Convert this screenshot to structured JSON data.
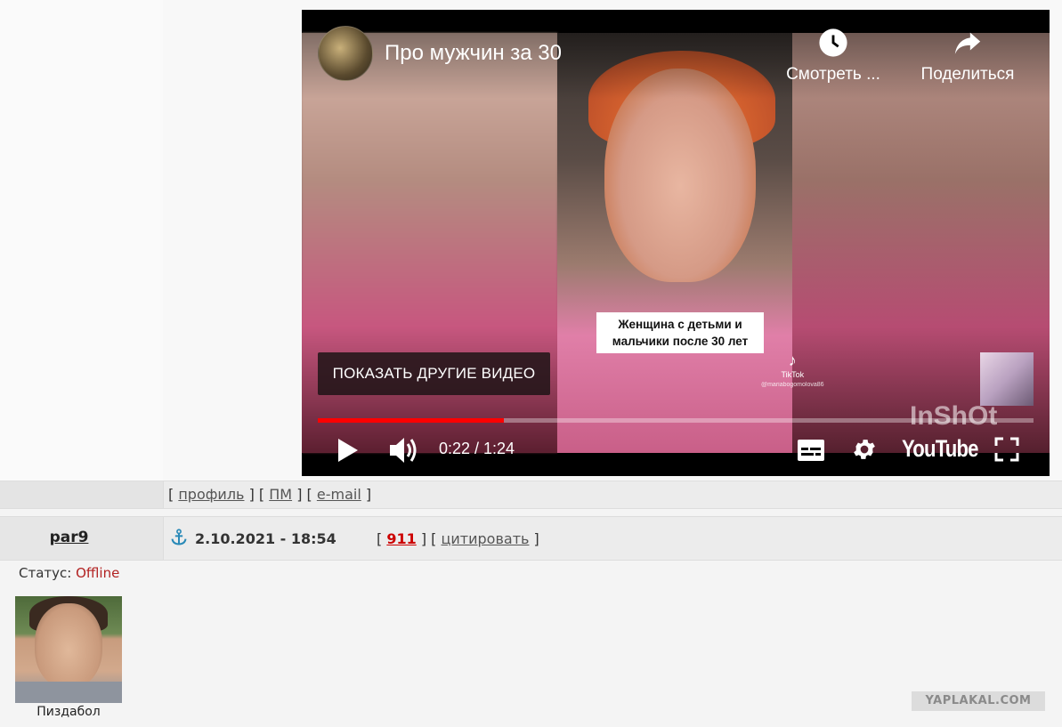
{
  "video": {
    "title": "Про мужчин за 30",
    "watch_later_label": "Смотреть ...",
    "share_label": "Поделиться",
    "caption_line1": "Женщина с детьми и",
    "caption_line2": "мальчики после 30 лет",
    "tiktok_label": "TikTok",
    "tiktok_handle": "@mariabogomolova86",
    "more_videos_label": "ПОКАЗАТЬ ДРУГИЕ ВИДЕО",
    "inshot_watermark": "InShOt",
    "time_current": "0:22",
    "time_total": "1:24",
    "time_display": "0:22 / 1:24",
    "progress": 0.26,
    "youtube_logo": "YouTube",
    "icons": [
      "clock-icon",
      "share-arrow-icon",
      "play-icon",
      "volume-icon",
      "subtitles-icon",
      "gear-icon",
      "fullscreen-icon"
    ],
    "accent_color": "#ff0000"
  },
  "profile_links": {
    "open": "[",
    "profile": "профиль",
    "sep1": "] [",
    "pm": "ПМ",
    "sep2": "] [",
    "email": "e-mail",
    "close": "]"
  },
  "post": {
    "username": "par9",
    "date": "2.10.2021 - 18:54",
    "number": "911",
    "quote_label": "цитировать",
    "bracket_open": "[",
    "bracket_mid": "] [",
    "bracket_close": "]"
  },
  "user": {
    "status_label": "Статус:",
    "status_value": "Offline",
    "rank": "Пиздабол"
  },
  "site_watermark": "YAPLAKAL.COM"
}
